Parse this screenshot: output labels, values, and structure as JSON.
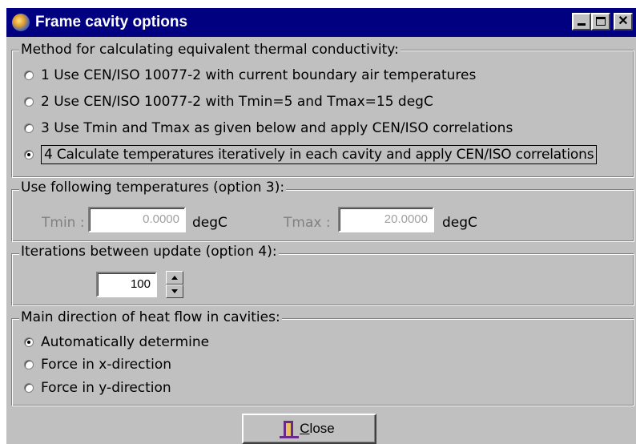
{
  "window": {
    "title": "Frame cavity options",
    "minimize_label": "_",
    "close_label": "✕"
  },
  "method_group": {
    "legend": "Method for calculating equivalent thermal conductivity:",
    "options": [
      {
        "label": "1 Use CEN/ISO 10077-2 with current boundary air temperatures",
        "checked": false
      },
      {
        "label": "2 Use CEN/ISO 10077-2 with Tmin=5 and Tmax=15 degC",
        "checked": false
      },
      {
        "label": "3 Use Tmin and Tmax as given below and apply CEN/ISO correlations",
        "checked": false
      },
      {
        "label": "4 Calculate temperatures iteratively in each cavity and apply CEN/ISO correlations",
        "checked": true
      }
    ]
  },
  "temperature_group": {
    "legend": "Use following temperatures (option 3):",
    "tmin_label": "Tmin :",
    "tmin_value": "0.0000",
    "tmin_unit": "degC",
    "tmax_label": "Tmax :",
    "tmax_value": "20.0000",
    "tmax_unit": "degC"
  },
  "iterations_group": {
    "legend": "Iterations between update (option 4):",
    "value": "100"
  },
  "direction_group": {
    "legend": "Main direction of heat flow in cavities:",
    "options": [
      {
        "label": "Automatically determine",
        "checked": true
      },
      {
        "label": "Force in x-direction",
        "checked": false
      },
      {
        "label": "Force in y-direction",
        "checked": false
      }
    ]
  },
  "close_button": {
    "label_mnemonic": "C",
    "label_rest": "lose"
  }
}
